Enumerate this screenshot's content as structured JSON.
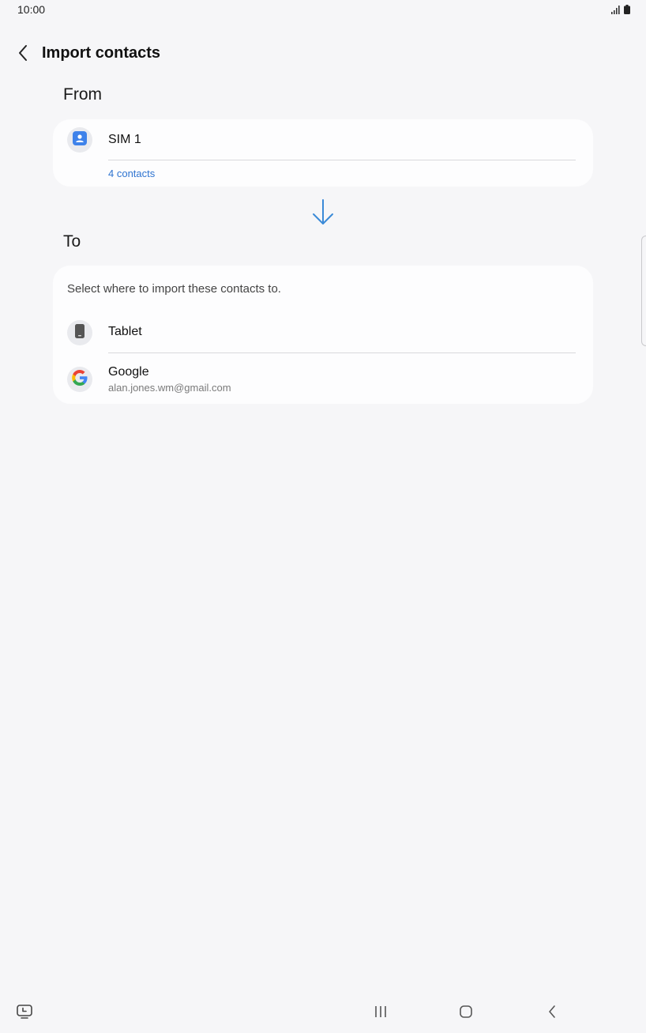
{
  "status_bar": {
    "time": "10:00"
  },
  "header": {
    "title": "Import contacts"
  },
  "from_section": {
    "heading": "From",
    "source": {
      "title": "SIM 1",
      "count_link": "4 contacts"
    }
  },
  "to_section": {
    "heading": "To",
    "note": "Select where to import these contacts to.",
    "options": [
      {
        "title": "Tablet",
        "subtitle": ""
      },
      {
        "title": "Google",
        "subtitle": "alan.jones.wm@gmail.com"
      }
    ]
  },
  "colors": {
    "background": "#f6f6f8",
    "card": "#fdfdfe",
    "accent_blue": "#2f74d0",
    "sim_icon_blue": "#3e82ea"
  },
  "icons": {
    "status": [
      "signal-icon",
      "battery-icon"
    ],
    "header": "chevron-left-icon",
    "arrow": "arrow-down-icon",
    "nav": [
      "screen-recorder-icon",
      "recent-apps-icon",
      "home-icon",
      "back-icon"
    ]
  }
}
